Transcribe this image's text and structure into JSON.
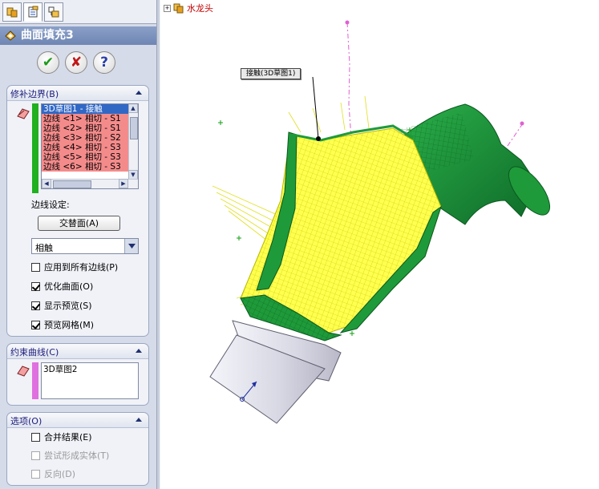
{
  "property_manager": {
    "tabs": [
      {
        "icon": "feature-manager-icon"
      },
      {
        "icon": "property-manager-icon"
      },
      {
        "icon": "configuration-manager-icon"
      }
    ],
    "title": "曲面填充3",
    "actions": {
      "ok": "✔",
      "cancel": "✘",
      "help": "?"
    },
    "patch_boundary": {
      "header": "修补边界(B)",
      "items": [
        {
          "label": "3D草图1 - 接触",
          "state": "selected"
        },
        {
          "label": "边线 <1> 相切 - S1",
          "state": "highlighted"
        },
        {
          "label": "边线 <2> 相切 - S1",
          "state": "highlighted"
        },
        {
          "label": "边线 <3> 相切 - S2",
          "state": "highlighted"
        },
        {
          "label": "边线 <4> 相切 - S3",
          "state": "highlighted"
        },
        {
          "label": "边线 <5> 相切 - S3",
          "state": "highlighted"
        },
        {
          "label": "边线 <6> 相切 - S3",
          "state": "highlighted"
        }
      ],
      "edge_settings_label": "边线设定:",
      "alternate_face_button": "交替面(A)",
      "curvature_control_value": "相触",
      "checkboxes": [
        {
          "label": "应用到所有边线(P)",
          "checked": false
        },
        {
          "label": "优化曲面(O)",
          "checked": true
        },
        {
          "label": "显示预览(S)",
          "checked": true
        },
        {
          "label": "预览网格(M)",
          "checked": true
        }
      ]
    },
    "constraint_curves": {
      "header": "约束曲线(C)",
      "items": [
        {
          "label": "3D草图2"
        }
      ]
    },
    "options": {
      "header": "选项(O)",
      "checkboxes": [
        {
          "label": "合并结果(E)",
          "checked": false,
          "enabled": true
        },
        {
          "label": "尝试形成实体(T)",
          "checked": false,
          "enabled": false
        },
        {
          "label": "反向(D)",
          "checked": false,
          "enabled": false
        }
      ]
    }
  },
  "graphics": {
    "tree_root": "水龙头",
    "callout": "接触(3D草图1)"
  },
  "colors": {
    "selection_blue": "#3168c6",
    "edge_highlight": "#f48b8b",
    "stripe_green": "#20b020",
    "stripe_magenta": "#e070e0",
    "preview_yellow": "#ffff40",
    "part_green": "#1f9a3a",
    "tree_label_red": "#c00000"
  }
}
